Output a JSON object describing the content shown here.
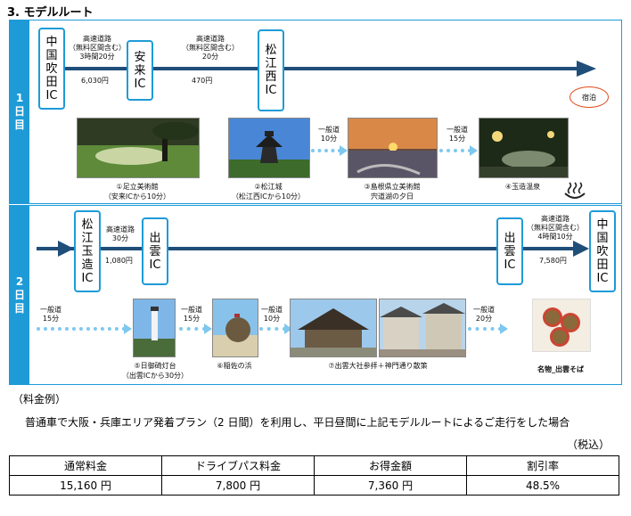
{
  "section_title": "3. モデルルート",
  "day1": {
    "label": [
      "1",
      "日",
      "目"
    ],
    "ic_start": [
      "中",
      "国",
      "吹",
      "田",
      "IC"
    ],
    "ic_mid": [
      "安",
      "来",
      "IC"
    ],
    "ic_end": [
      "松",
      "江",
      "西",
      "IC"
    ],
    "seg1_label": [
      "高速道路",
      "（無料区間含む）",
      "3時間20分"
    ],
    "seg1_price": "6,030円",
    "seg2_label": [
      "高速道路",
      "（無料区間含む）",
      "20分"
    ],
    "seg2_price": "470円",
    "stay": "宿泊",
    "leg1": [
      "一般道",
      "10分"
    ],
    "leg2": [
      "一般道",
      "15分"
    ],
    "spots": [
      {
        "caption": [
          "①足立美術館",
          "（安来ICから10分）"
        ]
      },
      {
        "caption": [
          "②松江城",
          "（松江西ICから10分）"
        ]
      },
      {
        "caption": [
          "③島根県立美術館",
          "宍道湖の夕日"
        ]
      },
      {
        "caption": [
          "④玉造温泉"
        ]
      }
    ]
  },
  "day2": {
    "label": [
      "2",
      "日",
      "目"
    ],
    "ic_start": [
      "松",
      "江",
      "玉",
      "造",
      "IC"
    ],
    "ic_mid": [
      "出",
      "雲",
      "IC"
    ],
    "ic_mid2": [
      "出",
      "雲",
      "IC"
    ],
    "ic_end": [
      "中",
      "国",
      "吹",
      "田",
      "IC"
    ],
    "seg1_label": [
      "高速道路",
      "30分"
    ],
    "seg1_price": "1,080円",
    "seg2_label": [
      "高速道路",
      "（無料区間含む）",
      "4時間10分"
    ],
    "seg2_price": "7,580円",
    "leg0": [
      "一般道",
      "15分"
    ],
    "leg1": [
      "一般道",
      "15分"
    ],
    "leg2": [
      "一般道",
      "10分"
    ],
    "leg3": [
      "一般道",
      "20分"
    ],
    "spots": [
      {
        "caption": [
          "⑤日御碕灯台",
          "（出雲ICから30分）"
        ]
      },
      {
        "caption": [
          "⑥稲佐の浜"
        ]
      },
      {
        "caption": [
          "⑦出雲大社参拝＋神門通り散策"
        ]
      },
      {
        "caption": [
          "名物_出雲そば"
        ]
      }
    ]
  },
  "fee_heading": "（料金例）",
  "fee_description": "普通車で大阪・兵庫エリア発着プラン（2 日間）を利用し、平日昼間に上記モデルルートによるご走行をした場合",
  "tax_note": "（税込）",
  "fee_table": {
    "headers": [
      "通常料金",
      "ドライブパス料金",
      "お得金額",
      "割引率"
    ],
    "values": [
      "15,160 円",
      "7,800 円",
      "7,360 円",
      "48.5%"
    ]
  },
  "colors": {
    "accent": "#1e9bd7",
    "route": "#1f4e79",
    "local_road": "#7ec8ef"
  }
}
